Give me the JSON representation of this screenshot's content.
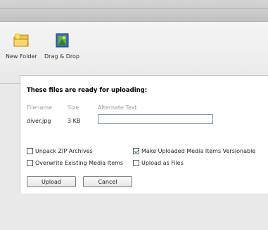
{
  "toolbar": {
    "new_folder": {
      "label": "New Folder",
      "icon": "folder-icon"
    },
    "drag_drop": {
      "label": "Drag & Drop",
      "icon": "drag-drop-icon"
    }
  },
  "dialog": {
    "title": "These files are ready for uploading:",
    "columns": {
      "filename": "Filename",
      "size": "Size",
      "alt": "Alternate Text"
    },
    "file": {
      "filename": "diver.jpg",
      "size": "3 KB",
      "alt_value": ""
    },
    "options": {
      "unpack_zip": {
        "label": "Unpack ZIP Archives",
        "checked": false
      },
      "versionable": {
        "label": "Make Uploaded Media Items Versionable",
        "checked": true
      },
      "overwrite": {
        "label": "Overwrite Existing Media Items",
        "checked": false
      },
      "upload_as_files": {
        "label": "Upload as Files",
        "checked": false
      }
    },
    "buttons": {
      "upload": "Upload",
      "cancel": "Cancel"
    }
  },
  "colors": {
    "input_border": "#6d8fb8",
    "check_mark": "#1a7d1a"
  }
}
